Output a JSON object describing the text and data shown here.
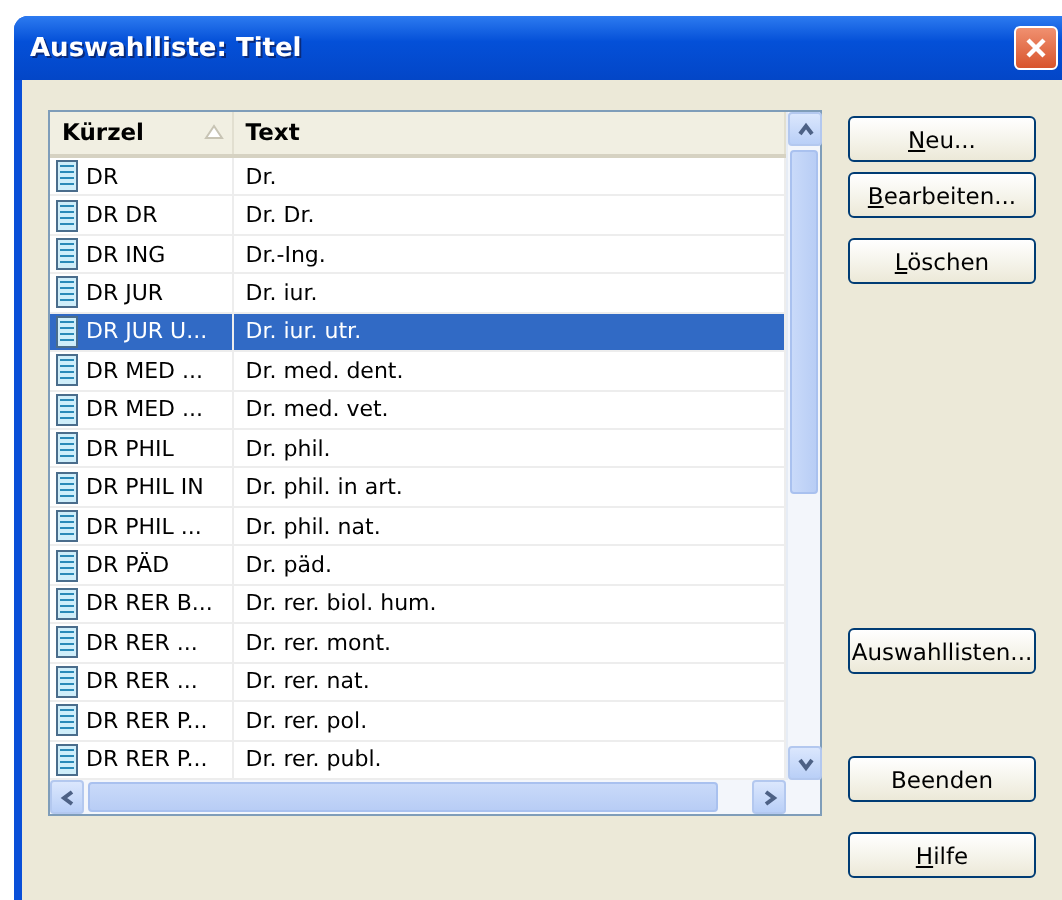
{
  "window": {
    "title": "Auswahlliste: Titel"
  },
  "table": {
    "columns": [
      {
        "label": "Kürzel",
        "sorted": true
      },
      {
        "label": "Text",
        "sorted": false
      }
    ],
    "rows": [
      {
        "code": "DR",
        "text": "Dr.",
        "selected": false
      },
      {
        "code": "DR DR",
        "text": "Dr. Dr.",
        "selected": false
      },
      {
        "code": "DR ING",
        "text": "Dr.-Ing.",
        "selected": false
      },
      {
        "code": "DR JUR",
        "text": "Dr. iur.",
        "selected": false
      },
      {
        "code": "DR JUR U...",
        "text": "Dr. iur. utr.",
        "selected": true
      },
      {
        "code": "DR MED ...",
        "text": "Dr. med. dent.",
        "selected": false
      },
      {
        "code": "DR MED ...",
        "text": "Dr. med. vet.",
        "selected": false
      },
      {
        "code": "DR PHIL",
        "text": "Dr. phil.",
        "selected": false
      },
      {
        "code": "DR PHIL IN",
        "text": "Dr. phil. in art.",
        "selected": false
      },
      {
        "code": "DR PHIL ...",
        "text": "Dr. phil. nat.",
        "selected": false
      },
      {
        "code": "DR PÄD",
        "text": "Dr. päd.",
        "selected": false
      },
      {
        "code": "DR RER B...",
        "text": "Dr. rer. biol. hum.",
        "selected": false
      },
      {
        "code": "DR RER ...",
        "text": "Dr. rer. mont.",
        "selected": false
      },
      {
        "code": "DR RER ...",
        "text": "Dr. rer. nat.",
        "selected": false
      },
      {
        "code": "DR RER P...",
        "text": "Dr. rer. pol.",
        "selected": false
      },
      {
        "code": "DR RER P...",
        "text": "Dr. rer. publ.",
        "selected": false
      }
    ]
  },
  "button_groups": [
    [
      {
        "key": "N",
        "rest": "eu..."
      },
      {
        "key": "B",
        "rest": "earbeiten..."
      },
      {
        "key": "L",
        "rest": "öschen"
      }
    ],
    [
      {
        "rest": "Auswahllisten..."
      }
    ],
    [
      {
        "rest": "Beenden"
      },
      {
        "key": "H",
        "rest": "ilfe"
      }
    ]
  ]
}
